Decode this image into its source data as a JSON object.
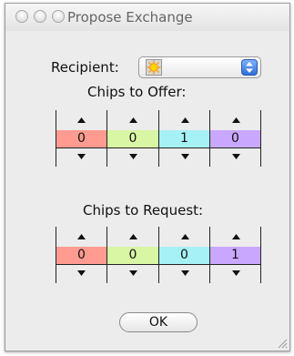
{
  "window": {
    "title": "Propose Exchange"
  },
  "recipient": {
    "label": "Recipient:",
    "icon": "sun-icon"
  },
  "offer": {
    "label": "Chips to Offer:",
    "values": [
      "0",
      "0",
      "1",
      "0"
    ]
  },
  "request": {
    "label": "Chips to Request:",
    "values": [
      "0",
      "0",
      "0",
      "1"
    ]
  },
  "chip_colors": [
    "#ff9b91",
    "#d8f6a3",
    "#a6f1f5",
    "#c9a7ff"
  ],
  "ok_label": "OK"
}
